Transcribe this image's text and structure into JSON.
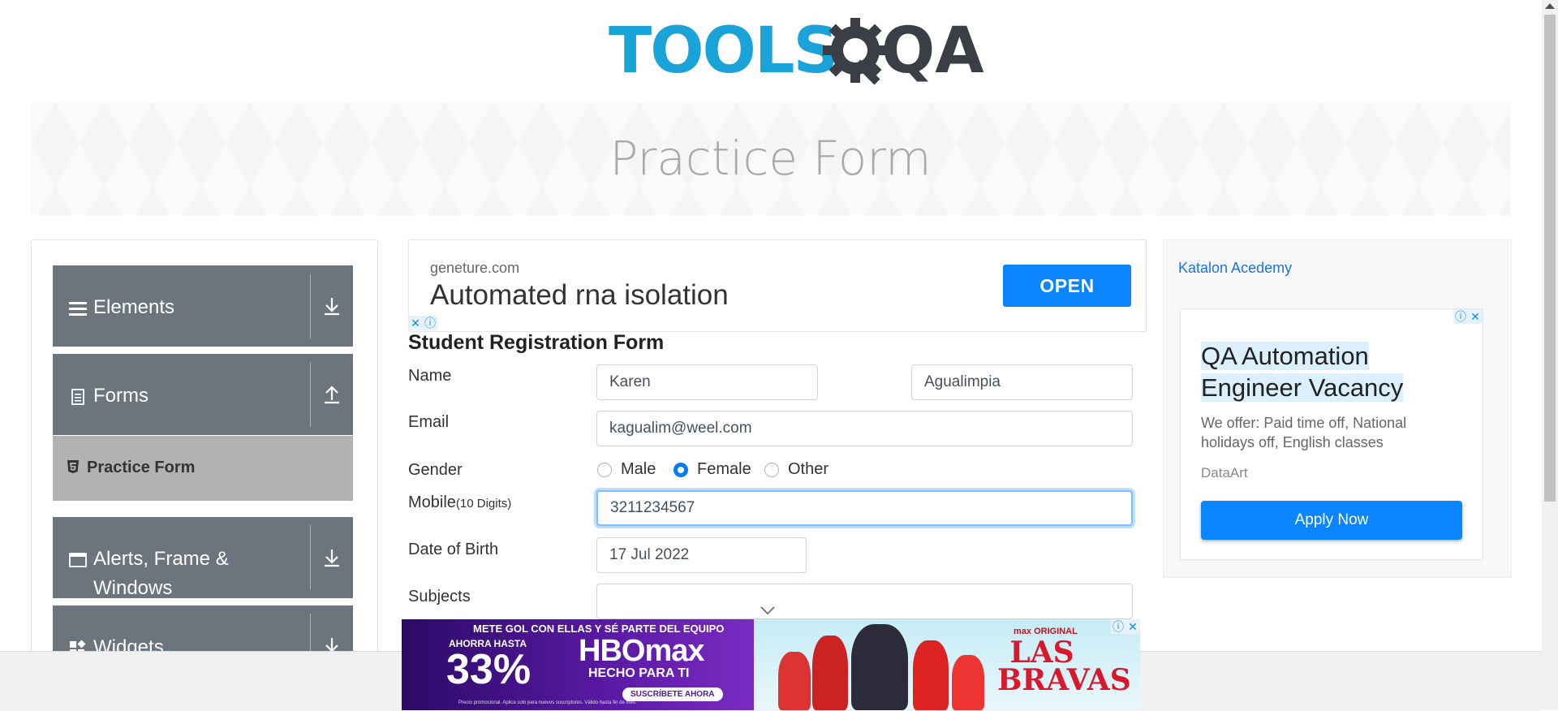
{
  "logo": {
    "text_left": "TOOLS",
    "text_right": "QA"
  },
  "page": {
    "title": "Practice Form"
  },
  "sidebar": {
    "groups": [
      {
        "label": "Elements",
        "icon": "hamburger-icon"
      },
      {
        "label": "Forms",
        "icon": "document-icon"
      },
      {
        "label": "Alerts, Frame &",
        "label2": "Windows",
        "icon": "window-icon"
      },
      {
        "label": "Widgets",
        "icon": "widgets-icon"
      }
    ],
    "active_item": {
      "label": "Practice Form"
    }
  },
  "ad_top": {
    "domain": "geneture.com",
    "headline": "Automated rna isolation",
    "button": "OPEN"
  },
  "form": {
    "title": "Student Registration Form",
    "name_label": "Name",
    "first_name": "Karen",
    "last_name": "Agualimpia",
    "email_label": "Email",
    "email": "kagualim@weel.com",
    "gender_label": "Gender",
    "gender_options": [
      "Male",
      "Female",
      "Other"
    ],
    "gender_selected": "Female",
    "mobile_label": "Mobile",
    "mobile_hint": "(10 Digits)",
    "mobile": "3211234567",
    "dob_label": "Date of Birth",
    "dob": "17 Jul 2022",
    "subjects_label": "Subjects",
    "subjects": ""
  },
  "ad_right": {
    "image_alt": "Katalon Acedemy",
    "headline": "QA Automation Engineer Vacancy",
    "description": "We offer: Paid time off, National holidays off, English classes",
    "advertiser": "DataArt",
    "button": "Apply Now"
  },
  "ad_bottom": {
    "tagline": "METE GOL CON ELLAS Y SÉ PARTE DEL EQUIPO",
    "upto": "AHORRA HASTA",
    "percent": "33%",
    "brand": "HBOmax",
    "subtitle": "HECHO PARA TI",
    "cta": "SUSCRÍBETE AHORA",
    "fine_print": "Precio promocional. Aplica solo para nuevos suscriptores. Válido hasta fin de mes.",
    "show_small": "max ORIGINAL",
    "show_title": "LAS BRAVAS"
  },
  "colors": {
    "accent": "#007bff",
    "sidebar_bg": "#6c757d",
    "active_bg": "#b2b2b2",
    "logo_blue": "#1aa3d9"
  }
}
